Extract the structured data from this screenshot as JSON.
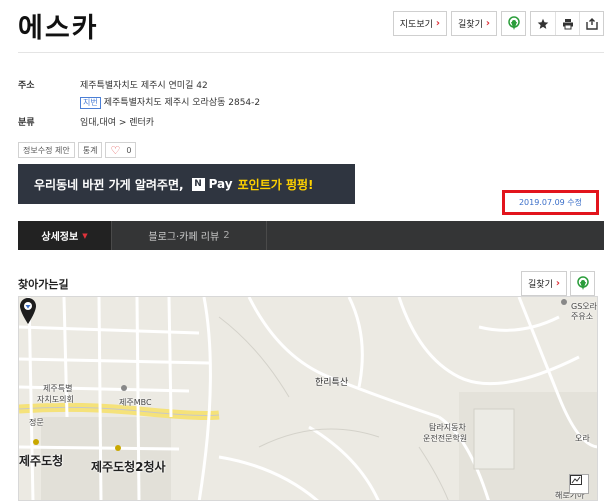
{
  "place": {
    "name": "에스카"
  },
  "top_buttons": {
    "map_label": "지도보기",
    "directions_label": "길찾기"
  },
  "info": {
    "address_label": "주소",
    "road_address": "제주특별자치도 제주시 연미길 42",
    "jibun_badge": "지번",
    "jibun_address": "제주특별자치도 제주시 오라삼동 2854-2",
    "category_label": "분류",
    "category_value": "임대,대여 > 렌터카"
  },
  "actions": {
    "suggest_edit": "정보수정 제안",
    "stats": "통계",
    "likes": "0"
  },
  "banner": {
    "text_before": "우리동네 바뀐 가게 알려주면,",
    "npay_n": "N",
    "npay_label": "Pay",
    "highlight": "포인트가 펑펑!"
  },
  "updated": "2019.07.09 수정",
  "tabs": {
    "detail": "상세정보",
    "reviews": "블로그·카페 리뷰",
    "reviews_count": "2"
  },
  "directions_section": {
    "title": "찾아가는길",
    "directions_label": "길찾기"
  },
  "map": {
    "labels": {
      "gs": "GS오라",
      "gs2": "주유소",
      "hanlibuk": "한리특산",
      "assembly1": "제주특별",
      "assembly2": "자치도의회",
      "mbc": "제주MBC",
      "jeongmun": "정문",
      "dochung": "제주도청",
      "dochung2": "제주도청2청사",
      "school1": "탐라지동차",
      "school2": "운전전문학원",
      "ora": "오라",
      "bottom": "해로기아"
    }
  },
  "colors": {
    "accent_red": "#e0323a",
    "link_blue": "#3b6fc9",
    "tab_bar": "#343536",
    "banner_bg": "#2f3540",
    "banner_highlight": "#ffd200",
    "pin_green": "#2a9d3a"
  },
  "icons": {
    "marker_pin": "map-pin-icon",
    "favorite": "star-icon",
    "print": "print-icon",
    "share": "share-icon",
    "heart": "heart-icon"
  }
}
